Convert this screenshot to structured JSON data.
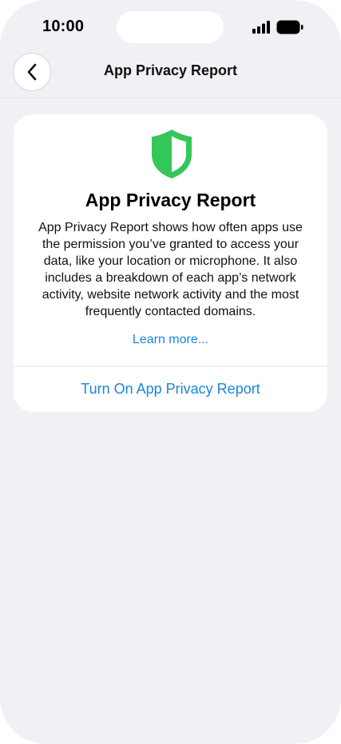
{
  "status_bar": {
    "time": "10:00",
    "signal_icon": "cellular-signal-icon",
    "battery_icon": "battery-icon"
  },
  "nav": {
    "title": "App Privacy Report",
    "back_icon": "chevron-left-icon"
  },
  "card": {
    "icon": "shield-icon",
    "title": "App Privacy Report",
    "description": "App Privacy Report shows how often apps use the permission you’ve granted to access your data, like your location or microphone. It also includes a breakdown of each app’s network activity, website network activity and the most frequently contacted domains.",
    "learn_more": "Learn more...",
    "action_label": "Turn On App Privacy Report"
  },
  "colors": {
    "background": "#f0f0f5",
    "card": "#ffffff",
    "accent_blue": "#1a86d9",
    "shield_green": "#34c759"
  }
}
